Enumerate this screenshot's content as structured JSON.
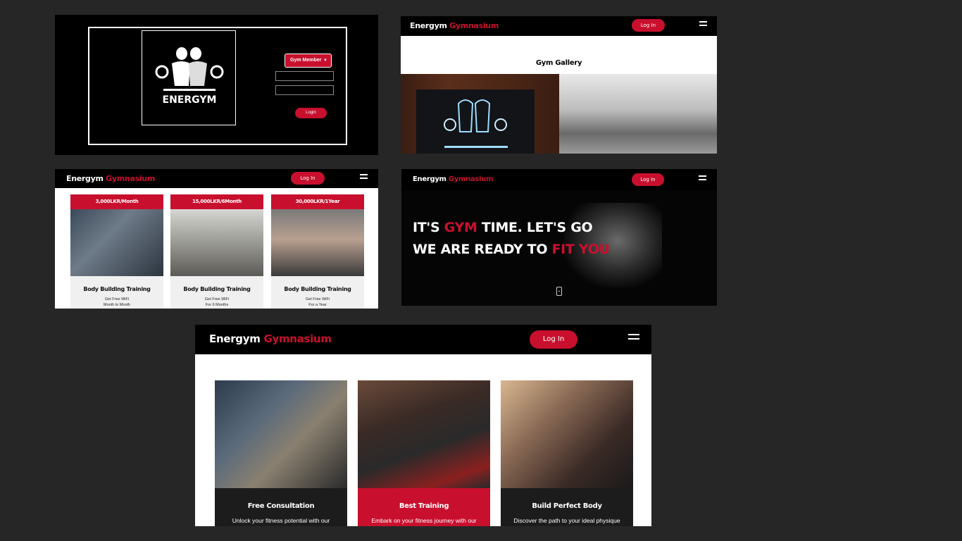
{
  "brand": {
    "name": "Energym",
    "accent": "Gymnasium"
  },
  "colors": {
    "brand_red": "#c8102e",
    "nav_bg": "#000000",
    "page_bg": "#262626"
  },
  "login_panel": {
    "logo_text": "ENERGYM",
    "role_select": "Gym Member",
    "login_button": "Login"
  },
  "gallery_panel": {
    "login_button": "Log In",
    "title": "Gym Gallery"
  },
  "pricing_panel": {
    "login_button": "Log In",
    "plans": [
      {
        "price": "3,000LKR/Month",
        "title": "Body Building Training",
        "line1": "Get Free WiFi",
        "line2": "Month to Month"
      },
      {
        "price": "15,000LKR/6Month",
        "title": "Body Building Training",
        "line1": "Get Free WiFi",
        "line2": "For 6 Months"
      },
      {
        "price": "30,000LKR/1Year",
        "title": "Body Building Training",
        "line1": "Get Free WiFi",
        "line2": "For a Year"
      }
    ]
  },
  "hero_panel": {
    "login_button": "Log In",
    "line1_pre": "IT'S ",
    "line1_accent": "GYM",
    "line1_post": " TIME. LET'S GO",
    "line2_pre": "WE ARE READY TO ",
    "line2_accent": "FIT YOU",
    "scroll_icon": "chevron-down-icon"
  },
  "services_panel": {
    "login_button": "Log In",
    "cards": [
      {
        "title": "Free Consultation",
        "desc": "Unlock your fitness potential with our",
        "bg": "#1c1c1c"
      },
      {
        "title": "Best Training",
        "desc": "Embark on your fitness journey with our",
        "bg": "#c8102e"
      },
      {
        "title": "Build Perfect Body",
        "desc": "Discover the path to your ideal physique",
        "bg": "#1c1c1c"
      }
    ]
  }
}
